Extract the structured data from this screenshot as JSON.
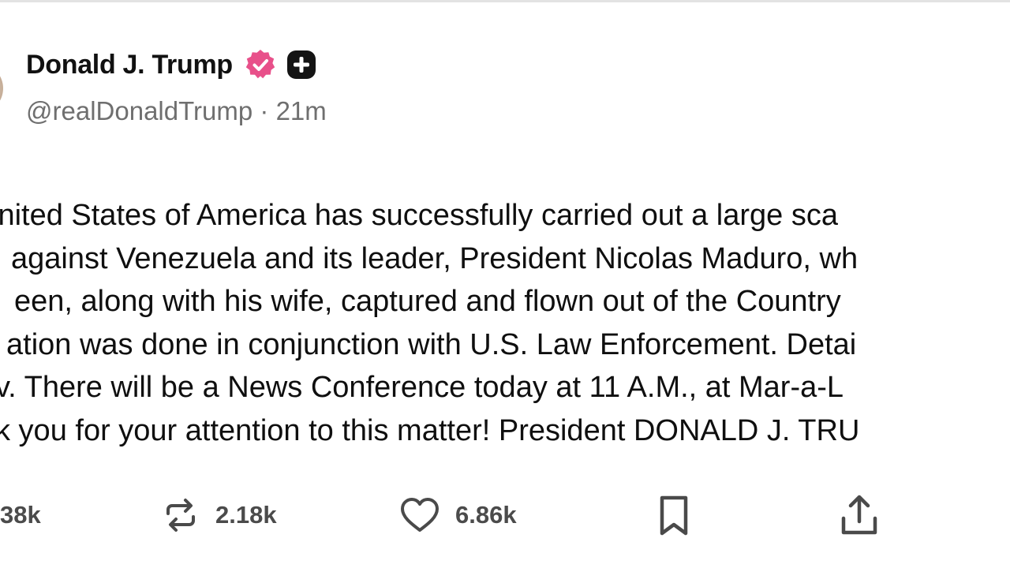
{
  "post": {
    "author": {
      "display_name": "Donald J. Trump",
      "handle": "@realDonaldTrump",
      "separator": " · ",
      "time_ago": "21m",
      "verified_badge_color": "#e8508a"
    },
    "body_lines": [
      "United States of America has successfully carried out a large sca",
      "against Venezuela and its leader, President Nicolas Maduro, wh",
      "een, along with his wife, captured and flown out of the Country",
      "ation was done in conjunction with U.S. Law Enforcement. Detai",
      "v. There will be a News Conference today at 11 A.M., at Mar-a-L",
      "k you for your attention to this matter! President DONALD J. TRU"
    ],
    "actions": {
      "replies": "38k",
      "reposts": "2.18k",
      "likes": "6.86k"
    }
  },
  "icons": {
    "verified": "verified-badge-icon",
    "plus": "plus-badge-icon",
    "reply": "reply-icon",
    "repost": "repost-icon",
    "like": "heart-icon",
    "bookmark": "bookmark-icon",
    "share": "share-icon"
  }
}
